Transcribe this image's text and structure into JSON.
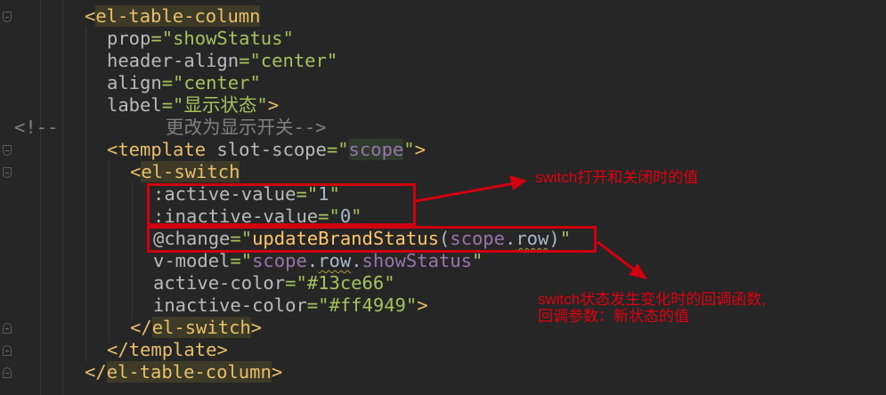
{
  "editor": {
    "lines": [
      {
        "tokens": [
          {
            "t": "<",
            "c": "br"
          },
          {
            "t": "el-table-column",
            "c": "tag"
          }
        ]
      },
      {
        "tokens": [
          {
            "t": "prop",
            "c": "attr"
          },
          {
            "t": "=\"",
            "c": "eq"
          },
          {
            "t": "showStatus",
            "c": "str"
          },
          {
            "t": "\"",
            "c": "eq"
          }
        ]
      },
      {
        "tokens": [
          {
            "t": "header-align",
            "c": "attr"
          },
          {
            "t": "=\"",
            "c": "eq"
          },
          {
            "t": "center",
            "c": "str"
          },
          {
            "t": "\"",
            "c": "eq"
          }
        ]
      },
      {
        "tokens": [
          {
            "t": "align",
            "c": "attr"
          },
          {
            "t": "=\"",
            "c": "eq"
          },
          {
            "t": "center",
            "c": "str"
          },
          {
            "t": "\"",
            "c": "eq"
          }
        ]
      },
      {
        "tokens": [
          {
            "t": "label",
            "c": "attr"
          },
          {
            "t": "=\"",
            "c": "eq"
          },
          {
            "t": "显示状态",
            "c": "str"
          },
          {
            "t": "\"",
            "c": "eq"
          },
          {
            "t": ">",
            "c": "br"
          }
        ]
      },
      {
        "tokens": [
          {
            "t": "<!--",
            "c": "cmt"
          }
        ]
      },
      {
        "tokens": [
          {
            "t": "更改为显示开关-->",
            "c": "cmt"
          }
        ]
      },
      {
        "tokens": [
          {
            "t": "<",
            "c": "br"
          },
          {
            "t": "template",
            "c": "br"
          },
          {
            "t": " slot-scope",
            "c": "attr"
          },
          {
            "t": "=\"",
            "c": "eq"
          },
          {
            "t": "scope",
            "c": "varbg"
          },
          {
            "t": "\"",
            "c": "eq"
          },
          {
            "t": ">",
            "c": "br"
          }
        ]
      },
      {
        "tokens": [
          {
            "t": "<",
            "c": "br"
          },
          {
            "t": "el-switch",
            "c": "tag"
          }
        ]
      },
      {
        "tokens": [
          {
            "t": ":active-value",
            "c": "attr"
          },
          {
            "t": "=\"",
            "c": "eq"
          },
          {
            "t": "1",
            "c": "num"
          },
          {
            "t": "\"",
            "c": "eq"
          }
        ]
      },
      {
        "tokens": [
          {
            "t": ":inactive-value",
            "c": "attr"
          },
          {
            "t": "=\"",
            "c": "eq"
          },
          {
            "t": "0",
            "c": "num"
          },
          {
            "t": "\"",
            "c": "eq"
          }
        ]
      },
      {
        "tokens": [
          {
            "t": "@change",
            "c": "attr"
          },
          {
            "t": "=\"",
            "c": "eq"
          },
          {
            "t": "updateBrandStatus",
            "c": "fn"
          },
          {
            "t": "(",
            "c": "plain"
          },
          {
            "t": "scope",
            "c": "var"
          },
          {
            "t": ".",
            "c": "plain"
          },
          {
            "t": "row",
            "c": "wavy"
          },
          {
            "t": ")",
            "c": "plain"
          },
          {
            "t": "\"",
            "c": "eq"
          }
        ]
      },
      {
        "tokens": [
          {
            "t": "v-model",
            "c": "attr"
          },
          {
            "t": "=\"",
            "c": "eq"
          },
          {
            "t": "scope",
            "c": "var"
          },
          {
            "t": ".",
            "c": "plain"
          },
          {
            "t": "row",
            "c": "wavy"
          },
          {
            "t": ".",
            "c": "plain"
          },
          {
            "t": "showStatus",
            "c": "var"
          },
          {
            "t": "\"",
            "c": "eq"
          }
        ]
      },
      {
        "tokens": [
          {
            "t": "active-color",
            "c": "attr"
          },
          {
            "t": "=\"",
            "c": "eq"
          },
          {
            "t": "#13ce66",
            "c": "str"
          },
          {
            "t": "\"",
            "c": "eq"
          }
        ]
      },
      {
        "tokens": [
          {
            "t": "inactive-color",
            "c": "attr"
          },
          {
            "t": "=\"",
            "c": "eq"
          },
          {
            "t": "#ff4949",
            "c": "str"
          },
          {
            "t": "\"",
            "c": "eq"
          },
          {
            "t": ">",
            "c": "br"
          }
        ]
      },
      {
        "tokens": [
          {
            "t": "</",
            "c": "br"
          },
          {
            "t": "el-switch",
            "c": "tag"
          },
          {
            "t": ">",
            "c": "br"
          }
        ]
      },
      {
        "tokens": [
          {
            "t": "</",
            "c": "br"
          },
          {
            "t": "template",
            "c": "br"
          },
          {
            "t": ">",
            "c": "br"
          }
        ]
      },
      {
        "tokens": [
          {
            "t": "</",
            "c": "br"
          },
          {
            "t": "el-table-column",
            "c": "tag"
          },
          {
            "t": ">",
            "c": "br"
          }
        ]
      }
    ]
  },
  "annotations": {
    "switch_values_note": "switch打开和关闭时的值",
    "change_note_line1": "switch状态发生变化时的回调函数,",
    "change_note_line2": "回调参数：新状态的值",
    "color": "#d0000f"
  }
}
